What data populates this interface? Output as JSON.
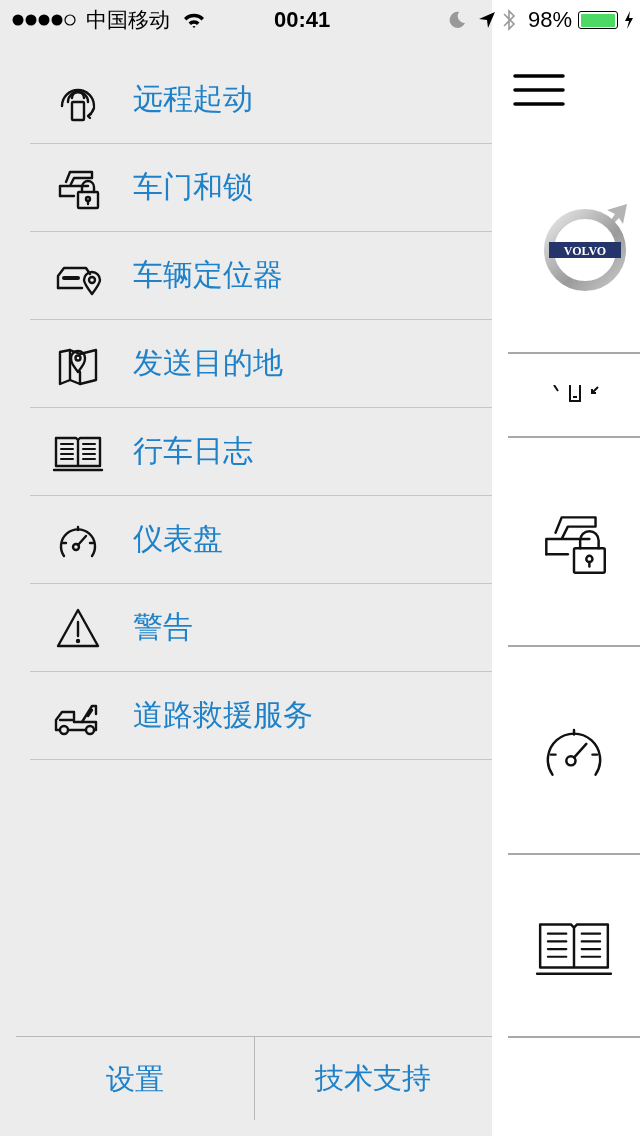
{
  "status_bar": {
    "carrier": "中国移动",
    "time": "00:41",
    "battery": "98%"
  },
  "menu": {
    "items": [
      {
        "kind": "remote",
        "label": "远程起动"
      },
      {
        "kind": "lock",
        "label": "车门和锁"
      },
      {
        "kind": "locator",
        "label": "车辆定位器"
      },
      {
        "kind": "map",
        "label": "发送目的地"
      },
      {
        "kind": "logbook",
        "label": "行车日志"
      },
      {
        "kind": "gauge",
        "label": "仪表盘"
      },
      {
        "kind": "warning",
        "label": "警告"
      },
      {
        "kind": "tow",
        "label": "道路救援服务"
      }
    ]
  },
  "footer": {
    "buttons": [
      "设置",
      "技术支持"
    ]
  },
  "side_panel": {
    "logo_text": "VOLVO",
    "tiles": [
      {
        "kind": "remote"
      },
      {
        "kind": "lock"
      },
      {
        "kind": "gauge"
      },
      {
        "kind": "logbook"
      }
    ]
  }
}
